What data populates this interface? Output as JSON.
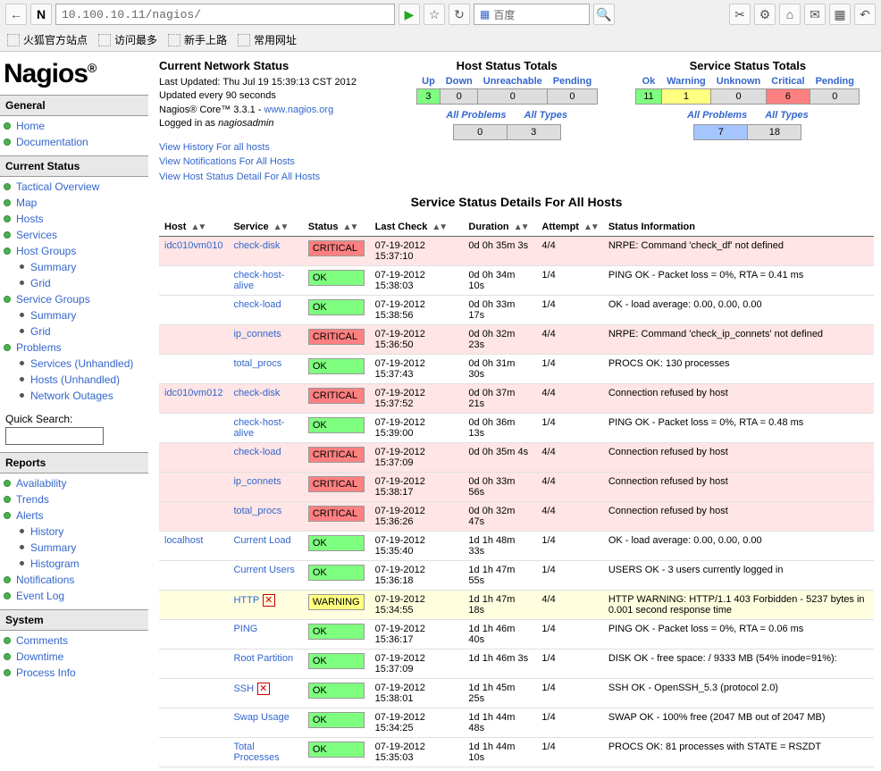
{
  "browser": {
    "url": "10.100.10.11/nagios/",
    "search_engine": "百度",
    "bookmarks": [
      "火狐官方站点",
      "访问最多",
      "新手上路",
      "常用网址"
    ]
  },
  "sidebar": {
    "sections": {
      "General": [
        {
          "label": "Home",
          "dot": true
        },
        {
          "label": "Documentation",
          "dot": true
        }
      ],
      "Current Status": [
        {
          "label": "Tactical Overview",
          "dot": true
        },
        {
          "label": "Map",
          "dot": true
        },
        {
          "label": "Hosts",
          "dot": true
        },
        {
          "label": "Services",
          "dot": true
        },
        {
          "label": "Host Groups",
          "dot": true
        },
        {
          "label": "Summary",
          "sub": true
        },
        {
          "label": "Grid",
          "sub": true
        },
        {
          "label": "Service Groups",
          "dot": true
        },
        {
          "label": "Summary",
          "sub": true
        },
        {
          "label": "Grid",
          "sub": true
        },
        {
          "label": "Problems",
          "dot": true
        },
        {
          "label": "Services (Unhandled)",
          "sub": true
        },
        {
          "label": "Hosts (Unhandled)",
          "sub": true
        },
        {
          "label": "Network Outages",
          "sub": true
        }
      ],
      "Reports": [
        {
          "label": "Availability",
          "dot": true
        },
        {
          "label": "Trends",
          "dot": true
        },
        {
          "label": "Alerts",
          "dot": true
        },
        {
          "label": "History",
          "sub": true
        },
        {
          "label": "Summary",
          "sub": true
        },
        {
          "label": "Histogram",
          "sub": true
        },
        {
          "label": "Notifications",
          "dot": true
        },
        {
          "label": "Event Log",
          "dot": true
        }
      ],
      "System": [
        {
          "label": "Comments",
          "dot": true
        },
        {
          "label": "Downtime",
          "dot": true
        },
        {
          "label": "Process Info",
          "dot": true
        }
      ]
    },
    "quick_search_label": "Quick Search:"
  },
  "current_network_status": {
    "title": "Current Network Status",
    "lines": [
      "Last Updated: Thu Jul 19 15:39:13 CST 2012",
      "Updated every 90 seconds",
      "Nagios® Core™ 3.3.1 - |www.nagios.org",
      "Logged in as |nagiosadmin"
    ],
    "links": [
      "View History For all hosts",
      "View Notifications For All Hosts",
      "View Host Status Detail For All Hosts"
    ]
  },
  "host_totals": {
    "title": "Host Status Totals",
    "cols": [
      "Up",
      "Down",
      "Unreachable",
      "Pending"
    ],
    "vals": [
      "3",
      "0",
      "0",
      "0"
    ],
    "cols2": [
      "All Problems",
      "All Types"
    ],
    "vals2": [
      "0",
      "3"
    ]
  },
  "service_totals": {
    "title": "Service Status Totals",
    "cols": [
      "Ok",
      "Warning",
      "Unknown",
      "Critical",
      "Pending"
    ],
    "vals": [
      "11",
      "1",
      "0",
      "6",
      "0"
    ],
    "cols2": [
      "All Problems",
      "All Types"
    ],
    "vals2": [
      "7",
      "18"
    ]
  },
  "page_title": "Service Status Details For All Hosts",
  "table": {
    "headers": [
      "Host",
      "Service",
      "Status",
      "Last Check",
      "Duration",
      "Attempt",
      "Status Information"
    ],
    "rows": [
      {
        "host": "idc010vm010",
        "host_show": true,
        "service": "check-disk",
        "status": "CRITICAL",
        "last_check": "07-19-2012 15:37:10",
        "duration": "0d 0h 35m 3s",
        "attempt": "4/4",
        "info": "NRPE: Command 'check_df' not defined"
      },
      {
        "host": "idc010vm010",
        "host_show": false,
        "service": "check-host-alive",
        "status": "OK",
        "last_check": "07-19-2012 15:38:03",
        "duration": "0d 0h 34m 10s",
        "attempt": "1/4",
        "info": "PING OK - Packet loss = 0%, RTA = 0.41 ms"
      },
      {
        "host": "idc010vm010",
        "host_show": false,
        "service": "check-load",
        "status": "OK",
        "last_check": "07-19-2012 15:38:56",
        "duration": "0d 0h 33m 17s",
        "attempt": "1/4",
        "info": "OK - load average: 0.00, 0.00, 0.00"
      },
      {
        "host": "idc010vm010",
        "host_show": false,
        "service": "ip_connets",
        "status": "CRITICAL",
        "last_check": "07-19-2012 15:36:50",
        "duration": "0d 0h 32m 23s",
        "attempt": "4/4",
        "info": "NRPE: Command 'check_ip_connets' not defined"
      },
      {
        "host": "idc010vm010",
        "host_show": false,
        "service": "total_procs",
        "status": "OK",
        "last_check": "07-19-2012 15:37:43",
        "duration": "0d 0h 31m 30s",
        "attempt": "1/4",
        "info": "PROCS OK: 130 processes"
      },
      {
        "host": "idc010vm012",
        "host_show": true,
        "service": "check-disk",
        "status": "CRITICAL",
        "last_check": "07-19-2012 15:37:52",
        "duration": "0d 0h 37m 21s",
        "attempt": "4/4",
        "info": "Connection refused by host"
      },
      {
        "host": "idc010vm012",
        "host_show": false,
        "service": "check-host-alive",
        "status": "OK",
        "last_check": "07-19-2012 15:39:00",
        "duration": "0d 0h 36m 13s",
        "attempt": "1/4",
        "info": "PING OK - Packet loss = 0%, RTA = 0.48 ms"
      },
      {
        "host": "idc010vm012",
        "host_show": false,
        "service": "check-load",
        "status": "CRITICAL",
        "last_check": "07-19-2012 15:37:09",
        "duration": "0d 0h 35m 4s",
        "attempt": "4/4",
        "info": "Connection refused by host"
      },
      {
        "host": "idc010vm012",
        "host_show": false,
        "service": "ip_connets",
        "status": "CRITICAL",
        "last_check": "07-19-2012 15:38:17",
        "duration": "0d 0h 33m 56s",
        "attempt": "4/4",
        "info": "Connection refused by host"
      },
      {
        "host": "idc010vm012",
        "host_show": false,
        "service": "total_procs",
        "status": "CRITICAL",
        "last_check": "07-19-2012 15:36:26",
        "duration": "0d 0h 32m 47s",
        "attempt": "4/4",
        "info": "Connection refused by host"
      },
      {
        "host": "localhost",
        "host_show": true,
        "service": "Current Load",
        "status": "OK",
        "last_check": "07-19-2012 15:35:40",
        "duration": "1d 1h 48m 33s",
        "attempt": "1/4",
        "info": "OK - load average: 0.00, 0.00, 0.00"
      },
      {
        "host": "localhost",
        "host_show": false,
        "service": "Current Users",
        "status": "OK",
        "last_check": "07-19-2012 15:36:18",
        "duration": "1d 1h 47m 55s",
        "attempt": "1/4",
        "info": "USERS OK - 3 users currently logged in"
      },
      {
        "host": "localhost",
        "host_show": false,
        "service": "HTTP",
        "icon": true,
        "status": "WARNING",
        "last_check": "07-19-2012 15:34:55",
        "duration": "1d 1h 47m 18s",
        "attempt": "4/4",
        "info": "HTTP WARNING: HTTP/1.1 403 Forbidden - 5237 bytes in 0.001 second response time"
      },
      {
        "host": "localhost",
        "host_show": false,
        "service": "PING",
        "status": "OK",
        "last_check": "07-19-2012 15:36:17",
        "duration": "1d 1h 46m 40s",
        "attempt": "1/4",
        "info": "PING OK - Packet loss = 0%, RTA = 0.06 ms"
      },
      {
        "host": "localhost",
        "host_show": false,
        "service": "Root Partition",
        "status": "OK",
        "last_check": "07-19-2012 15:37:09",
        "duration": "1d 1h 46m 3s",
        "attempt": "1/4",
        "info": "DISK OK - free space: / 9333 MB (54% inode=91%):"
      },
      {
        "host": "localhost",
        "host_show": false,
        "service": "SSH",
        "icon": true,
        "status": "OK",
        "last_check": "07-19-2012 15:38:01",
        "duration": "1d 1h 45m 25s",
        "attempt": "1/4",
        "info": "SSH OK - OpenSSH_5.3 (protocol 2.0)"
      },
      {
        "host": "localhost",
        "host_show": false,
        "service": "Swap Usage",
        "status": "OK",
        "last_check": "07-19-2012 15:34:25",
        "duration": "1d 1h 44m 48s",
        "attempt": "1/4",
        "info": "SWAP OK - 100% free (2047 MB out of 2047 MB)"
      },
      {
        "host": "localhost",
        "host_show": false,
        "service": "Total Processes",
        "status": "OK",
        "last_check": "07-19-2012 15:35:03",
        "duration": "1d 1h 44m 10s",
        "attempt": "1/4",
        "info": "PROCS OK: 81 processes with STATE = RSZDT"
      }
    ]
  }
}
